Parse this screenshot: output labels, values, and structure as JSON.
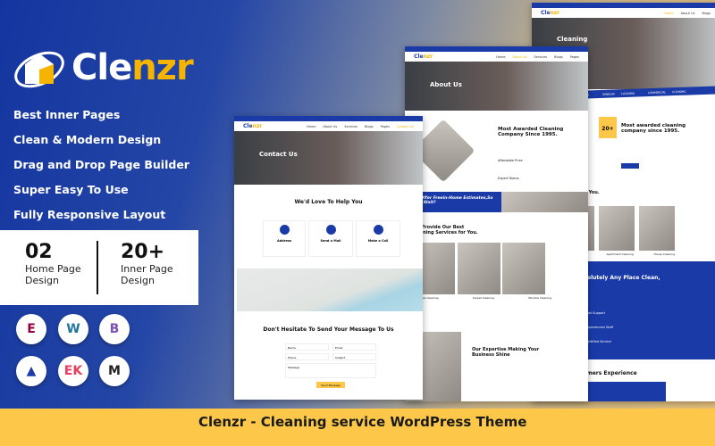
{
  "brand": {
    "name_part1": "Cle",
    "name_part2": "nzr",
    "accent": "#f5b400",
    "primary": "#1a3aa8",
    "band": "#fdc84a"
  },
  "features": [
    "Best Inner Pages",
    "Clean & Modern Design",
    "Drag and Drop Page Builder",
    "Super Easy To Use",
    "Fully Responsive Layout"
  ],
  "stats": [
    {
      "value": "02",
      "label": "Home Page Design"
    },
    {
      "value": "20+",
      "label": "Inner Page Design"
    }
  ],
  "plugins": [
    "elementor-icon",
    "wordpress-icon",
    "bootstrap-icon",
    "mountain-icon",
    "ekit-icon",
    "mailchimp-icon"
  ],
  "footer_title": "Clenzr - Cleaning service WordPress Theme",
  "nav": [
    "Home",
    "About Us",
    "Services",
    "Blogs",
    "Pages",
    "Contact Us"
  ],
  "contact": {
    "hero": "Contact Us",
    "help": "We'd Love To Help You",
    "cards": [
      "Address",
      "Send a Mail",
      "Make a Call"
    ],
    "form_title": "Don't Hesitate To Send Your Message To Us",
    "fields": [
      "Name",
      "Email",
      "Phone",
      "Subject",
      "Message"
    ],
    "submit": "Send Message"
  },
  "about": {
    "hero": "About Us",
    "award": "Most Awarded Cleaning Company Since 1995.",
    "features": [
      "Affordable Price",
      "Expert Teams"
    ],
    "banner": "We Offer Freein-Home Estimates,So Why Wait?",
    "services_title": "We Provide Our Best Cleaning Services for You.",
    "services": [
      "House Cleaning",
      "Carpet Cleaning",
      "Window Cleaning"
    ],
    "expertise": "Our Expertise Making Your Business Shine"
  },
  "home": {
    "hero": "Cleaning",
    "ticker": [
      "CARPET CLEANING",
      "WINDOW CLEANING",
      "COMMERCIAL CLEANING"
    ],
    "badge": "20+",
    "award": "Most awarded cleaning company since 1995.",
    "services_title": "Our Best Services for You.",
    "services": [
      "Residential Cleaning",
      "Apartment Cleaning",
      "House Cleaning"
    ],
    "promise": "We Will Make Absolutely Any Place Clean, Neat & Tidy.",
    "points": [
      "Fast Support",
      "Experienced Staff",
      "Certified Service"
    ],
    "testimonials": "Customers Experience"
  }
}
